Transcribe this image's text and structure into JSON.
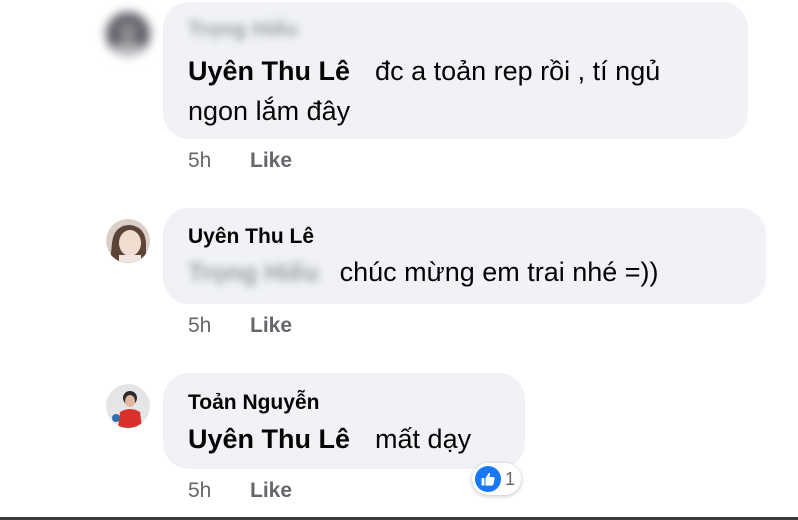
{
  "comments": [
    {
      "author": "Trọng Hiếu",
      "mention": "Uyên Thu Lê",
      "text_line1": "đc a toản rep rồi , tí ngủ",
      "text_line2": "ngon lắm đây",
      "time": "5h",
      "like_label": "Like"
    },
    {
      "author": "Uyên Thu Lê",
      "mention": "Trọng Hiếu",
      "text_line1": "chúc mừng em trai nhé =))",
      "time": "5h",
      "like_label": "Like"
    },
    {
      "author": "Toản Nguyễn",
      "mention": "Uyên Thu Lê",
      "text_line1": "mất dạy",
      "time": "5h",
      "like_label": "Like",
      "reaction": {
        "icon": "like-icon",
        "count": "1",
        "color": "#1877f2"
      }
    }
  ]
}
